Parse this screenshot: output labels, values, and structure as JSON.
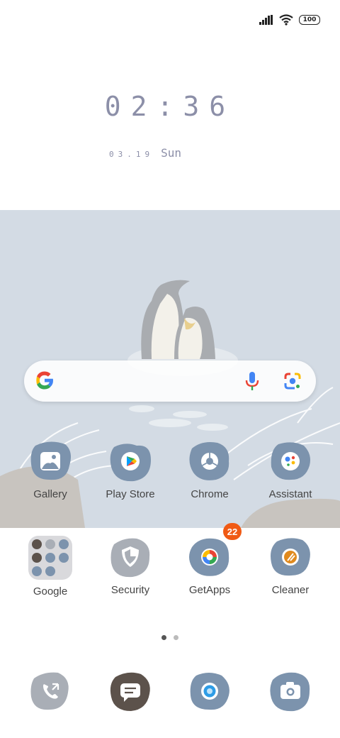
{
  "status_bar": {
    "battery": "100",
    "icons": [
      "signal-icon",
      "wifi-icon",
      "battery-icon"
    ]
  },
  "clock": {
    "time": "02:36",
    "date_num": "03.19",
    "day": "Sun"
  },
  "search_widget": {
    "icons": [
      "google-logo-icon",
      "microphone-icon",
      "lens-camera-icon"
    ]
  },
  "apps_row1": [
    {
      "label": "Gallery"
    },
    {
      "label": "Play Store"
    },
    {
      "label": "Chrome"
    },
    {
      "label": "Assistant"
    }
  ],
  "apps_row2": [
    {
      "label": "Google"
    },
    {
      "label": "Security"
    },
    {
      "label": "GetApps",
      "badge": "22"
    },
    {
      "label": "Cleaner"
    }
  ],
  "page_indicator": {
    "pages": 2,
    "active": 1
  },
  "dock": {
    "icons": [
      "phone-icon",
      "messages-icon",
      "browser-icon",
      "camera-icon"
    ]
  },
  "colors": {
    "blob_blue": "#7c93ad",
    "blob_gray": "#a9aeb6",
    "blob_brown": "#5c524b",
    "wallpaper": "#d3dbe4",
    "badge": "#f05a14"
  }
}
